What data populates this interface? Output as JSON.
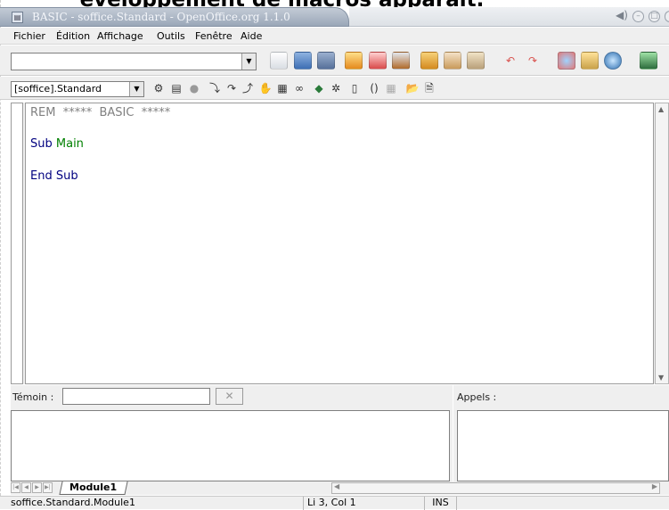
{
  "caption": "éveloppement de macros apparaît.",
  "window": {
    "title": "BASIC - soffice.Standard - OpenOffice.org 1.1.0",
    "controls": [
      "sound",
      "minimize",
      "maximize",
      "close"
    ]
  },
  "menu": {
    "items": [
      "Fichier",
      "Édition",
      "Affichage",
      "Outils",
      "Fenêtre",
      "Aide"
    ]
  },
  "toolbar_standard": {
    "url_value": "",
    "icons": [
      "new-document-icon",
      "open-folder-icon",
      "save-icon",
      "edit-file-icon",
      "export-pdf-icon",
      "print-icon",
      "cut-icon",
      "copy-icon",
      "paste-icon",
      "undo-icon",
      "redo-icon",
      "navigator-icon",
      "gallery-icon",
      "help-icon",
      "view-toggle-icon"
    ]
  },
  "toolbar_macro": {
    "library_value": "[soffice].Standard",
    "icons": [
      "compile-icon",
      "run-basic-icon",
      "stop-icon",
      "step-into-icon",
      "step-over-icon",
      "step-out-icon",
      "breakpoint-icon",
      "manage-breakpoints-icon",
      "enable-watch-icon",
      "object-catalog-icon",
      "macros-icon",
      "modules-icon",
      "find-parentheses-icon",
      "insert-controls-icon",
      "insert-source-icon",
      "save-source-icon"
    ]
  },
  "editor": {
    "line1_kw": "REM",
    "line1_rest": "  *****  BASIC  *****",
    "line2_kw": "Sub",
    "line2_name": "Main",
    "line3_kw": "End Sub"
  },
  "watch": {
    "label": "Témoin :",
    "input_value": ""
  },
  "calls": {
    "label": "Appels :"
  },
  "tabs": {
    "module_name": "Module1"
  },
  "status": {
    "location": "soffice.Standard.Module1",
    "cursor": "Li 3, Col 1",
    "mode": "INS"
  },
  "colors": {
    "keyword": "#000080",
    "comment": "#808080",
    "identifier": "#008000",
    "title_bar": "#9aa7b8"
  }
}
